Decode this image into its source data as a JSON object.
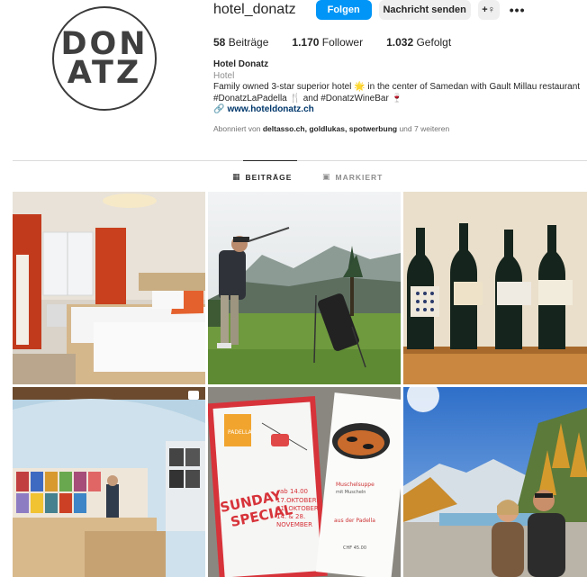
{
  "profile": {
    "avatar_line1": "DON",
    "avatar_line2": "ATZ",
    "username": "hotel_donatz",
    "follow_label": "Folgen",
    "message_label": "Nachricht senden",
    "suggest_icon": "+♀",
    "more_icon": "•••"
  },
  "stats": {
    "posts_count": "58",
    "posts_label": " Beiträge",
    "followers_count": "1.170",
    "followers_label": " Follower",
    "following_count": "1.032",
    "following_label": " Gefolgt"
  },
  "bio": {
    "name": "Hotel Donatz",
    "category": "Hotel",
    "line1": "Family owned 3-star superior hotel 🌟 in the center of Samedan with Gault Millau restaurant",
    "line2": "#DonatzLaPadella 🍴 and #DonatzWineBar 🍷",
    "link_icon": "🔗",
    "link": "www.hoteldonatz.ch",
    "followed_prefix": "Abonniert von ",
    "followed_names": "deltasso.ch, goldlukas, spotwerbung",
    "followed_suffix": " und 7 weiteren"
  },
  "tabs": {
    "posts_icon": "▦",
    "posts_label": "BEITRÄGE",
    "tagged_icon": "▣",
    "tagged_label": "MARKIERT"
  },
  "posts": [
    {
      "name": "hotel-room"
    },
    {
      "name": "golf"
    },
    {
      "name": "wine-bottles"
    },
    {
      "name": "wine-bar-interior"
    },
    {
      "name": "sunday-special-flyer",
      "flyer_brand": "PADELLA",
      "flyer_title1": "SUNDAY",
      "flyer_title2": "SPECIAL",
      "flyer_dates1": "17.OKTOBER",
      "flyer_dates2": "31. OKTOBER",
      "flyer_dates3": "14. & 28.",
      "flyer_dates4": "NOVEMBER",
      "flyer_time": "ab 14.00",
      "flyer_menu1": "Muschelsuppe",
      "flyer_menu2": "mit Muscheln",
      "flyer_menu3": "aus der Padella",
      "flyer_price": "CHF 45.00"
    },
    {
      "name": "couple-mountains"
    }
  ]
}
